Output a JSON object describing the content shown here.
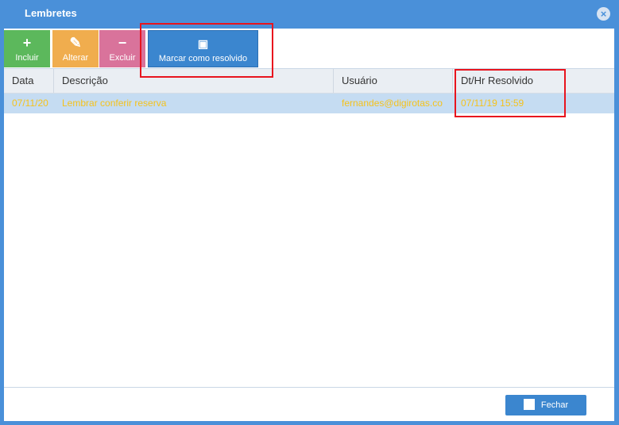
{
  "window": {
    "title": "Lembretes"
  },
  "toolbar": {
    "incluir": {
      "label": "Incluir",
      "icon": "plus-icon"
    },
    "alterar": {
      "label": "Alterar",
      "icon": "edit-icon"
    },
    "excluir": {
      "label": "Excluir",
      "icon": "minus-icon"
    },
    "marcar": {
      "label": "Marcar como resolvido",
      "icon": "calendar-check-icon"
    }
  },
  "grid": {
    "columns": [
      "Data",
      "Descrição",
      "Usuário",
      "Dt/Hr Resolvido"
    ],
    "rows": [
      [
        "07/11/20",
        "Lembrar conferir reserva",
        "fernandes@digirotas.co",
        "07/11/19 15:59"
      ]
    ]
  },
  "footer": {
    "close_label": "Fechar"
  },
  "colors": {
    "accent": "#4a90d9",
    "selected_row": "#c5dcf2",
    "row_text": "#f5c21c",
    "highlight": "#e8141e"
  }
}
